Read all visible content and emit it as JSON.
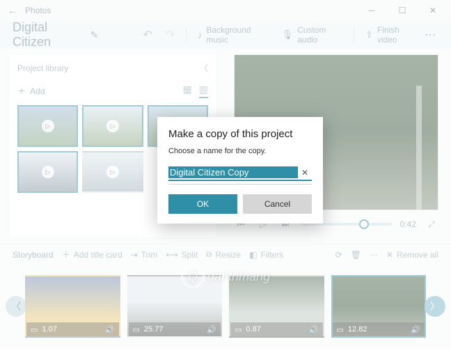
{
  "titlebar": {
    "title": "Photos"
  },
  "header": {
    "project_name": "Digital Citizen",
    "bg_music": "Background music",
    "custom_audio": "Custom audio",
    "finish_video": "Finish video"
  },
  "library": {
    "title": "Project library",
    "add": "Add"
  },
  "playback": {
    "time": "0:42"
  },
  "storyboard": {
    "title": "Storyboard",
    "add_title_card": "Add title card",
    "trim": "Trim",
    "split": "Split",
    "resize": "Resize",
    "filters": "Filters",
    "remove_all": "Remove all"
  },
  "clips": [
    {
      "duration": "1.07"
    },
    {
      "duration": "25.77"
    },
    {
      "duration": "0.87"
    },
    {
      "duration": "12.82"
    }
  ],
  "modal": {
    "title": "Make a copy of this project",
    "subtitle": "Choose a name for the copy.",
    "value": "Digital Citizen Copy",
    "ok": "OK",
    "cancel": "Cancel"
  },
  "watermark": "uantrimang"
}
